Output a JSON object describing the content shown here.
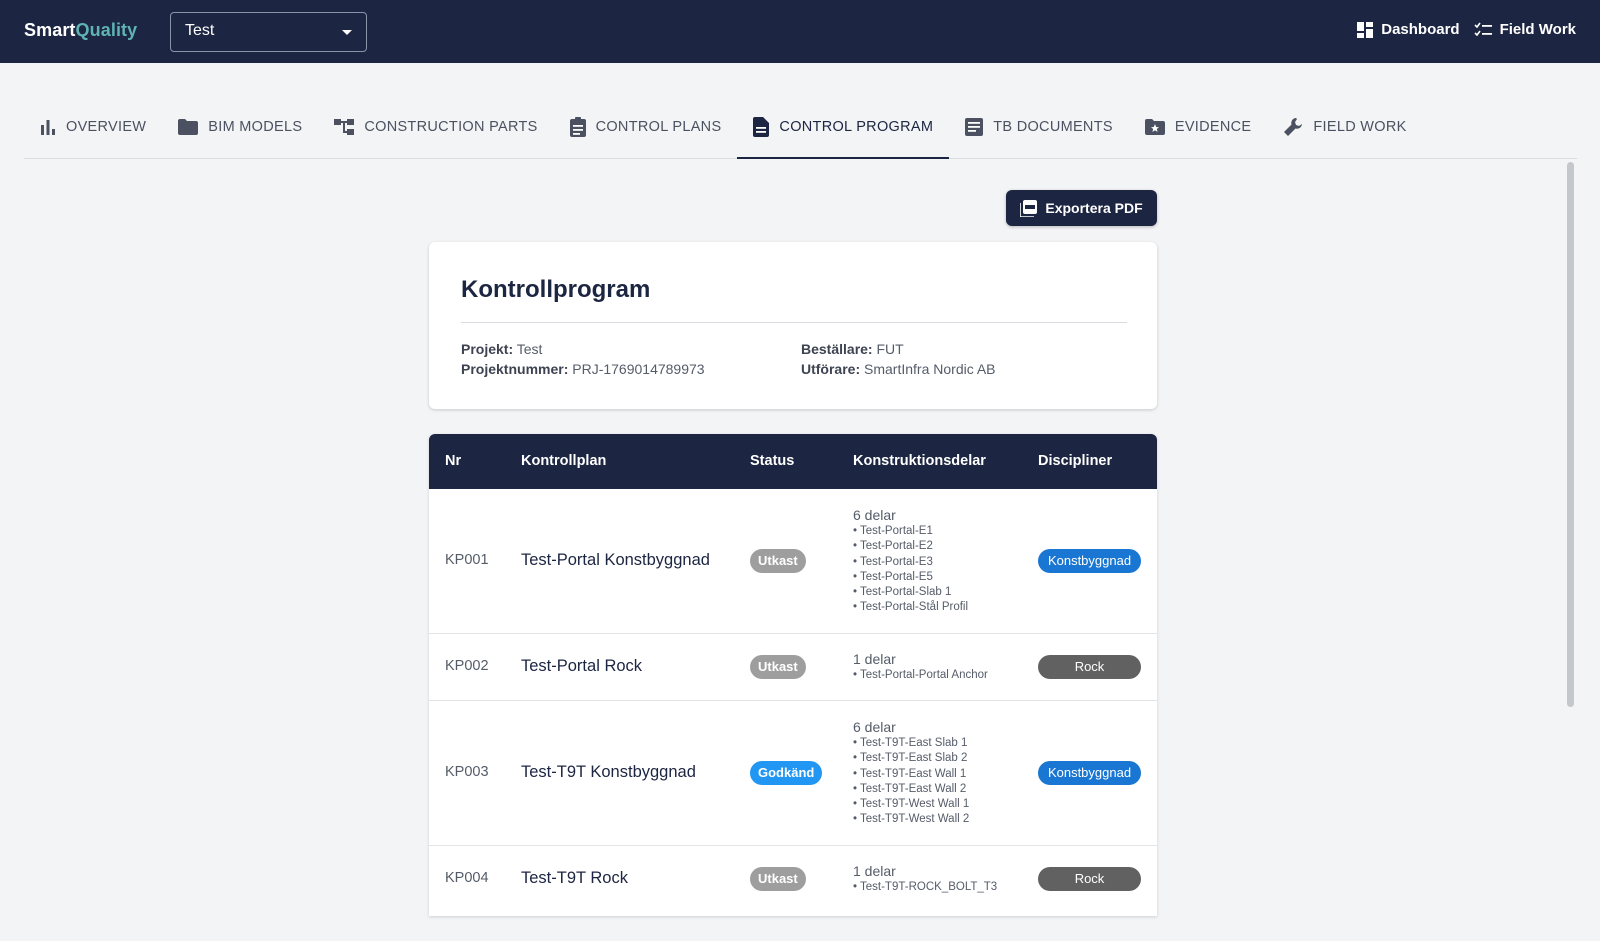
{
  "app": {
    "brand_part1": "Smart",
    "brand_part2": "Quality",
    "project_select": "Test",
    "top_links": [
      {
        "label": "Dashboard",
        "icon": "dashboard-icon"
      },
      {
        "label": "Field Work",
        "icon": "checklist-icon"
      }
    ]
  },
  "tabs": [
    {
      "label": "OVERVIEW",
      "icon": "bar-chart-icon"
    },
    {
      "label": "BIM MODELS",
      "icon": "folder-icon"
    },
    {
      "label": "CONSTRUCTION PARTS",
      "icon": "account-tree-icon"
    },
    {
      "label": "CONTROL PLANS",
      "icon": "clipboard-icon"
    },
    {
      "label": "CONTROL PROGRAM",
      "icon": "document-icon",
      "active": true
    },
    {
      "label": "TB DOCUMENTS",
      "icon": "article-icon"
    },
    {
      "label": "EVIDENCE",
      "icon": "folder-star-icon"
    },
    {
      "label": "FIELD WORK",
      "icon": "wrench-icon"
    }
  ],
  "export_button": "Exportera PDF",
  "program": {
    "title": "Kontrollprogram",
    "projekt_label": "Projekt:",
    "projekt_value": "Test",
    "projektnummer_label": "Projektnummer:",
    "projektnummer_value": "PRJ-1769014789973",
    "bestallare_label": "Beställare:",
    "bestallare_value": "FUT",
    "utforare_label": "Utförare:",
    "utforare_value": "SmartInfra Nordic AB"
  },
  "table": {
    "headers": [
      "Nr",
      "Kontrollplan",
      "Status",
      "Konstruktionsdelar",
      "Discipliner"
    ],
    "rows": [
      {
        "nr": "KP001",
        "name": "Test-Portal Konstbyggnad",
        "status": "Utkast",
        "count": "6 delar",
        "parts": [
          "Test-Portal-E1",
          "Test-Portal-E2",
          "Test-Portal-E3",
          "Test-Portal-E5",
          "Test-Portal-Slab 1",
          "Test-Portal-Stål Profil"
        ],
        "discipline": "Konstbyggnad"
      },
      {
        "nr": "KP002",
        "name": "Test-Portal Rock",
        "status": "Utkast",
        "count": "1 delar",
        "parts": [
          "Test-Portal-Portal Anchor"
        ],
        "discipline": "Rock"
      },
      {
        "nr": "KP003",
        "name": "Test-T9T Konstbyggnad",
        "status": "Godkänd",
        "count": "6 delar",
        "parts": [
          "Test-T9T-East Slab 1",
          "Test-T9T-East Slab 2",
          "Test-T9T-East Wall 1",
          "Test-T9T-East Wall 2",
          "Test-T9T-West Wall 1",
          "Test-T9T-West Wall 2"
        ],
        "discipline": "Konstbyggnad"
      },
      {
        "nr": "KP004",
        "name": "Test-T9T Rock",
        "status": "Utkast",
        "count": "1 delar",
        "parts": [
          "Test-T9T-ROCK_BOLT_T3"
        ],
        "discipline": "Rock"
      }
    ]
  },
  "colors": {
    "appbar": "#1c2541",
    "brand_accent": "#5fb3b3",
    "status_utkast": "#9e9e9e",
    "status_godkand": "#2196f3",
    "disc_konstbyggnad": "#1976d2",
    "disc_rock": "#616161"
  }
}
